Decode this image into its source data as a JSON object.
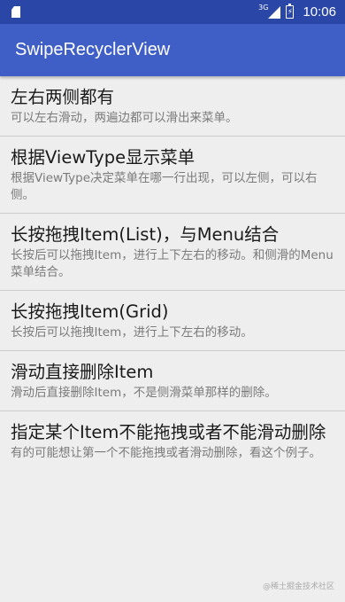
{
  "status_bar": {
    "network": "3G",
    "time": "10:06"
  },
  "app_bar": {
    "title": "SwipeRecyclerView"
  },
  "items": [
    {
      "title": "左右两侧都有",
      "desc": "可以左右滑动，两遍边都可以滑出来菜单。"
    },
    {
      "title": "根据ViewType显示菜单",
      "desc": "根据ViewType决定菜单在哪一行出现，可以左侧，可以右侧。"
    },
    {
      "title": "长按拖拽Item(List)，与Menu结合",
      "desc": "长按后可以拖拽Item，进行上下左右的移动。和侧滑的Menu菜单结合。"
    },
    {
      "title": "长按拖拽Item(Grid)",
      "desc": "长按后可以拖拽Item，进行上下左右的移动。"
    },
    {
      "title": "滑动直接删除Item",
      "desc": "滑动后直接删除Item，不是侧滑菜单那样的删除。"
    },
    {
      "title": "指定某个Item不能拖拽或者不能滑动删除",
      "desc": "有的可能想让第一个不能拖拽或者滑动删除，看这个例子。"
    }
  ],
  "watermark": "@稀土掘金技术社区",
  "colors": {
    "status_bar": "#2a47a7",
    "app_bar": "#3f5fc6",
    "background": "#eeeeee"
  }
}
